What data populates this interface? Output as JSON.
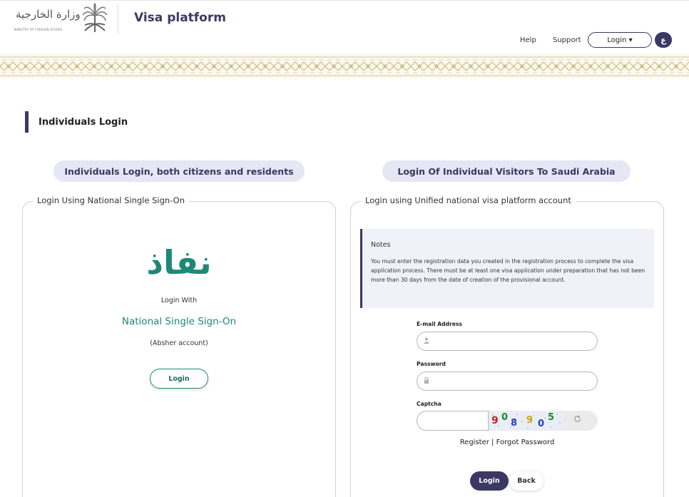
{
  "header": {
    "logo_arabic": "وزارة الخارجية",
    "logo_english": "MINISTRY OF FOREIGN AFFAIRS",
    "platform_title": "Visa platform",
    "nav": {
      "help": "Help",
      "support": "Support",
      "login": "Login ▾",
      "language": "ع"
    }
  },
  "section": {
    "title": "Individuals Login"
  },
  "left": {
    "pill": "Individuals Login, both citizens and residents",
    "legend": "Login Using National Single Sign-On",
    "nafath_logo_text": "نفاذ",
    "login_with": "Login With",
    "service_name": "National Single Sign-On",
    "absher": "(Absher account)",
    "login_button": "Login"
  },
  "right": {
    "pill": "Login Of Individual Visitors To Saudi Arabia",
    "legend": "Login using Unified national visa platform account",
    "notes": {
      "title": "Notes",
      "body": "You must enter the registration data you created in the registration process to complete the visa application process. There must be at least one visa application under preparation that has not been more than 30 days from the date of creation of the provisional account."
    },
    "form": {
      "email_label": "E-mail Address",
      "password_label": "Password",
      "captcha_label": "Captcha",
      "captcha_code": "908905"
    },
    "links": "Register | Forgot Password",
    "login_button": "Login",
    "back_button": "Back"
  },
  "colors": {
    "brand": "#3b3864",
    "nafath": "#1e8877",
    "pill_bg": "#e6e6f4",
    "pattern": "#d7c89a"
  }
}
